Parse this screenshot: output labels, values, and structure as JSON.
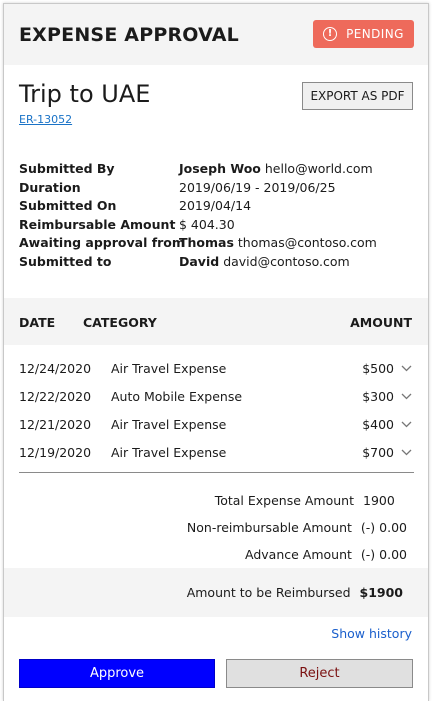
{
  "header": {
    "title": "EXPENSE APPROVAL",
    "status": "PENDING",
    "status_icon": "info-icon"
  },
  "trip": {
    "title": "Trip to UAE",
    "report_id": "ER-13052",
    "export_label": "EXPORT AS PDF"
  },
  "facts": {
    "submitted_by_label": "Submitted By",
    "submitted_by_name": "Joseph Woo",
    "submitted_by_email": "hello@world.com",
    "duration_label": "Duration",
    "duration_value": "2019/06/19 - 2019/06/25",
    "submitted_on_label": "Submitted On",
    "submitted_on_value": "2019/04/14",
    "reimbursable_label": "Reimbursable Amount",
    "reimbursable_value": "$ 404.30",
    "awaiting_label": "Awaiting approval from",
    "awaiting_name": "Thomas",
    "awaiting_email": "thomas@contoso.com",
    "submitted_to_label": "Submitted to",
    "submitted_to_name": "David",
    "submitted_to_email": "david@contoso.com"
  },
  "table": {
    "headers": {
      "date": "DATE",
      "category": "CATEGORY",
      "amount": "AMOUNT"
    },
    "rows": [
      {
        "date": "12/24/2020",
        "category": "Air Travel Expense",
        "amount": "$500"
      },
      {
        "date": "12/22/2020",
        "category": "Auto Mobile Expense",
        "amount": "$300"
      },
      {
        "date": "12/21/2020",
        "category": "Air Travel Expense",
        "amount": "$400"
      },
      {
        "date": "12/19/2020",
        "category": "Air Travel Expense",
        "amount": "$700"
      }
    ]
  },
  "totals": {
    "total_label": "Total Expense Amount",
    "total_value": "1900",
    "nonreimb_label": "Non-reimbursable Amount",
    "nonreimb_value": "(-) 0.00",
    "advance_label": "Advance Amount",
    "advance_value": "(-) 0.00",
    "reimbursed_label": "Amount to be Reimbursed",
    "reimbursed_value": "$1900"
  },
  "actions": {
    "history": "Show history",
    "approve": "Approve",
    "reject": "Reject"
  },
  "colors": {
    "approve": "#0000ff",
    "pending": "#ee6a5b",
    "link": "#1a5fcc"
  }
}
